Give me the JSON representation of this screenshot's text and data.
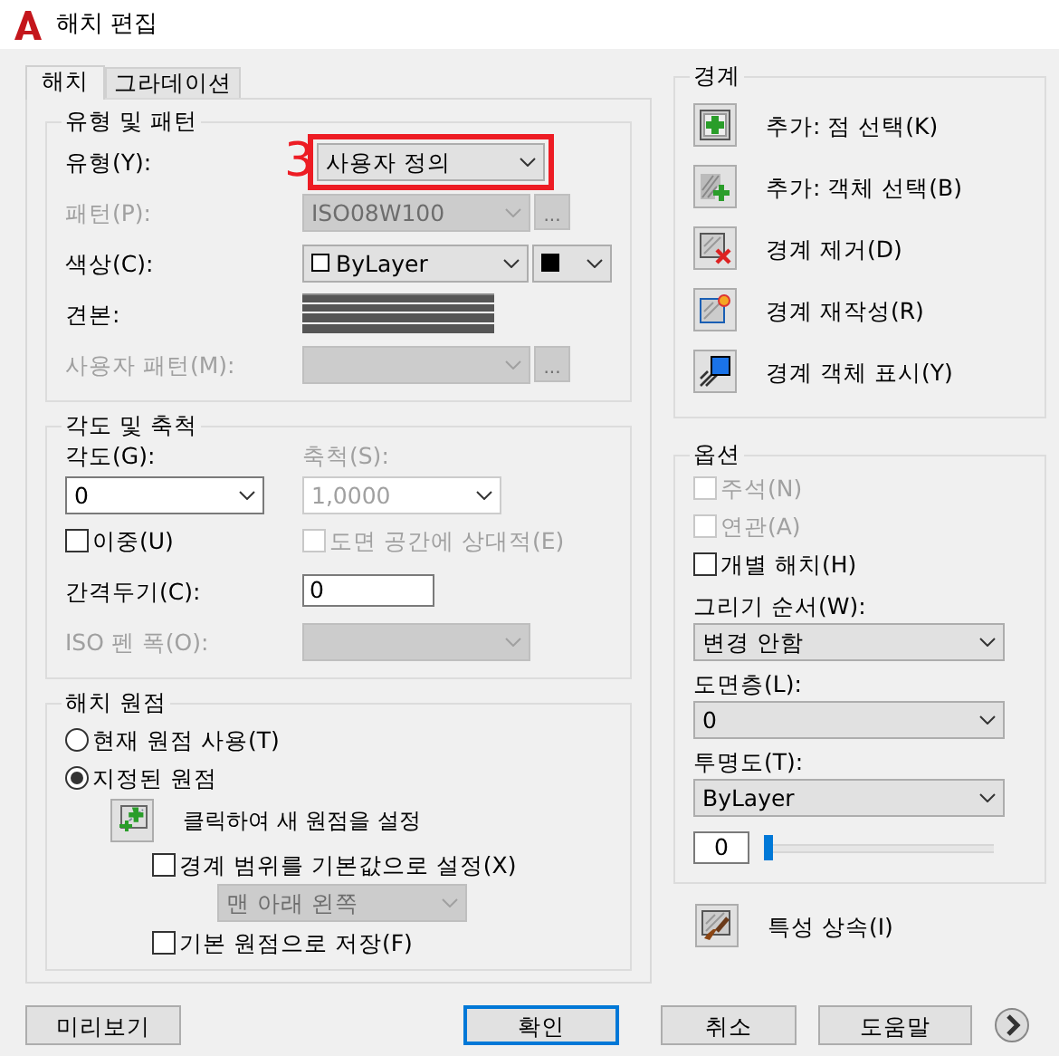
{
  "window": {
    "title": "해치 편집"
  },
  "tabs": [
    {
      "label": "해치",
      "selected": true
    },
    {
      "label": "그라데이션",
      "selected": false
    }
  ],
  "annotation": {
    "text": "3"
  },
  "type_pattern": {
    "title": "유형 및 패턴",
    "fields": [
      {
        "kind": "select",
        "label": "유형(Y):",
        "value": "사용자 정의",
        "disabled": false,
        "highlighted": true
      },
      {
        "kind": "select",
        "label": "패턴(P):",
        "value": "ISO08W100",
        "disabled": true,
        "highlighted": false,
        "browse": "..."
      },
      {
        "kind": "color",
        "label": "색상(C):",
        "value": "ByLayer",
        "disabled": false,
        "highlighted": false
      },
      {
        "kind": "swatch",
        "label": "견본:",
        "disabled": false,
        "highlighted": false
      },
      {
        "kind": "select",
        "label": "사용자 패턴(M):",
        "disabled": true,
        "highlighted": false,
        "browse": "..."
      }
    ]
  },
  "angle_scale": {
    "title": "각도 및 축척",
    "angle": {
      "label": "각도(G):",
      "value": "0",
      "disabled": false
    },
    "scale": {
      "label": "축척(S):",
      "value": "1,0000",
      "disabled": true
    },
    "double": {
      "label": "이중(U)",
      "checked": false,
      "disabled": false
    },
    "relative": {
      "label": "도면 공간에 상대적(E)",
      "checked": false,
      "disabled": true
    },
    "spacing": {
      "label": "간격두기(C):",
      "value": "0"
    },
    "iso_pen": {
      "label": "ISO 펜 폭(O):",
      "disabled": true
    }
  },
  "origin": {
    "title": "해치 원점",
    "options": [
      {
        "label": "현재 원점 사용(T)",
        "selected": false
      },
      {
        "label": "지정된 원점",
        "selected": true
      }
    ],
    "click_button": {
      "label": "클릭하여 새 원점을 설정"
    },
    "default_extents": {
      "label": "경계 범위를 기본값으로 설정(X)",
      "checked": false
    },
    "position": {
      "value": "맨 아래 왼쪽",
      "disabled": true
    },
    "store": {
      "label": "기본 원점으로 저장(F)",
      "checked": false
    }
  },
  "boundaries": {
    "title": "경계",
    "actions": [
      {
        "kind": "pick-points",
        "label": "추가: 점 선택(K)"
      },
      {
        "kind": "select-objects",
        "label": "추가: 객체 선택(B)"
      },
      {
        "kind": "remove",
        "label": "경계 제거(D)"
      },
      {
        "kind": "recreate",
        "label": "경계 재작성(R)"
      },
      {
        "kind": "display",
        "label": "경계 객체 표시(Y)"
      }
    ]
  },
  "options": {
    "title": "옵션",
    "checks": [
      {
        "label": "주석(N)",
        "checked": false,
        "disabled": true
      },
      {
        "label": "연관(A)",
        "checked": false,
        "disabled": true
      },
      {
        "label": "개별 해치(H)",
        "checked": false,
        "disabled": false
      }
    ],
    "dropdowns": [
      {
        "label": "그리기 순서(W):",
        "value": "변경 안함"
      },
      {
        "label": "도면층(L):",
        "value": "0"
      },
      {
        "label": "투명도(T):",
        "value": "ByLayer"
      }
    ],
    "transparency_amount": "0",
    "level": 0
  },
  "inherit": {
    "label": "특성 상속(I)"
  },
  "buttons": [
    {
      "label": "미리보기",
      "default": false
    },
    {
      "label": "확인",
      "default": true
    },
    {
      "label": "취소",
      "default": false
    },
    {
      "label": "도움말",
      "default": false
    }
  ]
}
